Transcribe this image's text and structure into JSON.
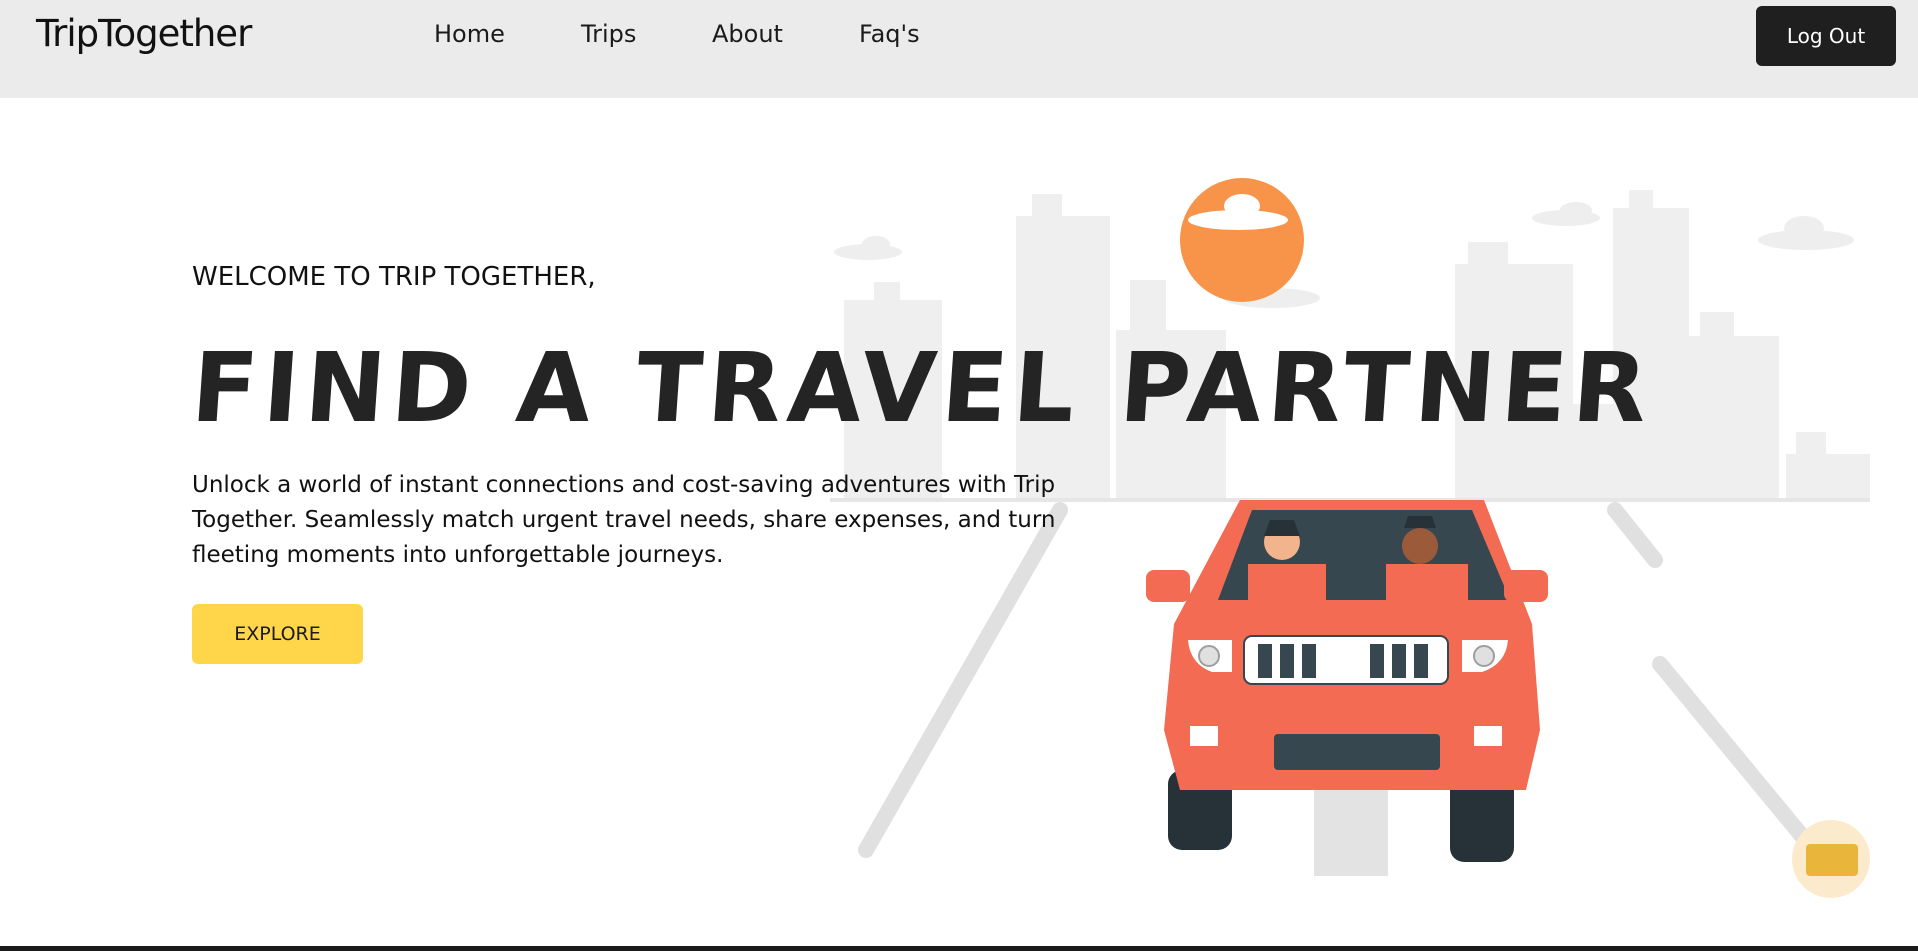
{
  "navbar": {
    "brand": "TripTogether",
    "links": [
      "Home",
      "Trips",
      "About",
      "Faq's"
    ],
    "logout_label": "Log Out"
  },
  "hero": {
    "welcome": "WELCOME TO TRIP TOGETHER,",
    "title": "FIND A TRAVEL PARTNER",
    "description": "Unlock a world of instant connections and cost-saving adventures with Trip Together. Seamlessly match urgent travel needs, share expenses, and turn fleeting moments into unforgettable journeys.",
    "cta_label": "EXPLORE"
  },
  "illustration": {
    "subject": "red car with two travelers on city road",
    "colors": {
      "car": "#f26b52",
      "sun": "#f7944a",
      "buildings": "#efefef",
      "road": "#e3e3e3"
    }
  },
  "widget": {
    "icon": "chat-widget-icon",
    "color": "#e9b53a"
  }
}
